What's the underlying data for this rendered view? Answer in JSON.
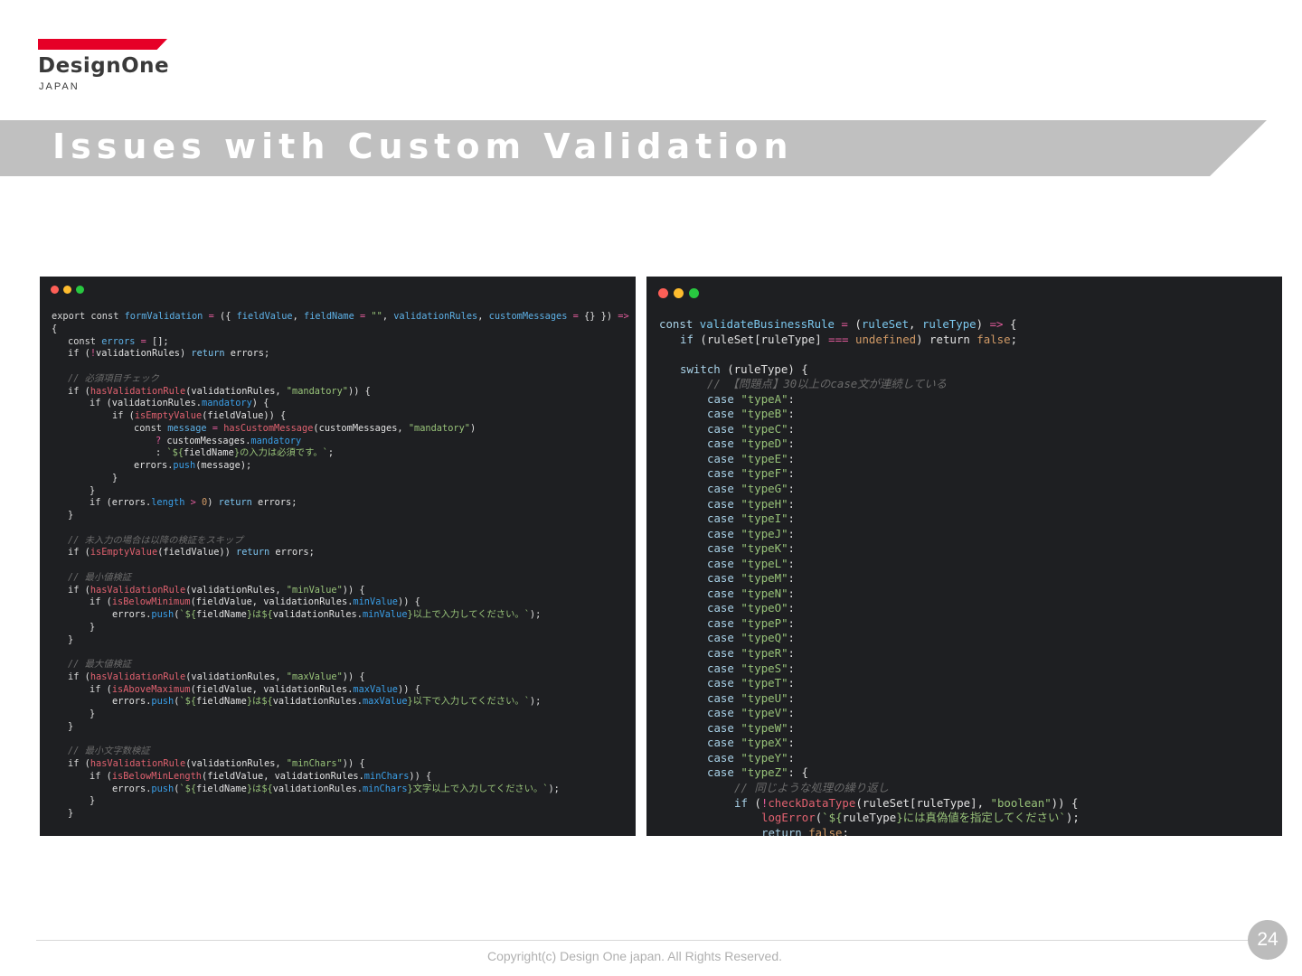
{
  "logo": {
    "name": "DesignOne",
    "sub": "JAPAN",
    "brand_color": "#e60027"
  },
  "title": "Issues with Custom Validation",
  "footer": {
    "copyright": "Copyright(c) Design One japan. All Rights Reserved.",
    "page_number": "24"
  },
  "left_code": [
    {
      "i": 0,
      "t": [
        [
          "k",
          "export const "
        ],
        [
          "v",
          "formValidation"
        ],
        [
          "o",
          " = "
        ],
        [
          "t",
          "({ "
        ],
        [
          "v",
          "fieldValue"
        ],
        [
          "t",
          ", "
        ],
        [
          "v",
          "fieldName"
        ],
        [
          "o",
          " = "
        ],
        [
          "s",
          "\"\""
        ],
        [
          "t",
          ", "
        ],
        [
          "v",
          "validationRules"
        ],
        [
          "t",
          ", "
        ],
        [
          "v",
          "customMessages"
        ],
        [
          "o",
          " = "
        ],
        [
          "t",
          "{} }) "
        ],
        [
          "o",
          "=>"
        ]
      ]
    },
    {
      "i": 0,
      "t": [
        [
          "t",
          "{"
        ]
      ]
    },
    {
      "i": 1,
      "t": [
        [
          "k",
          "const "
        ],
        [
          "v",
          "errors"
        ],
        [
          "o",
          " = "
        ],
        [
          "t",
          "[];"
        ]
      ]
    },
    {
      "i": 1,
      "t": [
        [
          "k",
          "if "
        ],
        [
          "t",
          "("
        ],
        [
          "o",
          "!"
        ],
        [
          "t",
          "validationRules) "
        ],
        [
          "r",
          "return"
        ],
        [
          "t",
          " errors;"
        ]
      ]
    },
    {
      "i": 0,
      "t": []
    },
    {
      "i": 1,
      "t": [
        [
          "c",
          "// 必須項目チェック"
        ]
      ]
    },
    {
      "i": 1,
      "t": [
        [
          "k",
          "if "
        ],
        [
          "t",
          "("
        ],
        [
          "f",
          "hasValidationRule"
        ],
        [
          "t",
          "(validationRules, "
        ],
        [
          "s",
          "\"mandatory\""
        ],
        [
          "t",
          ")) {"
        ]
      ]
    },
    {
      "i": 2,
      "t": [
        [
          "k",
          "if "
        ],
        [
          "t",
          "(validationRules."
        ],
        [
          "p",
          "mandatory"
        ],
        [
          "t",
          ") {"
        ]
      ]
    },
    {
      "i": 3,
      "t": [
        [
          "k",
          "if "
        ],
        [
          "t",
          "("
        ],
        [
          "f",
          "isEmptyValue"
        ],
        [
          "t",
          "(fieldValue)) {"
        ]
      ]
    },
    {
      "i": 4,
      "t": [
        [
          "k",
          "const "
        ],
        [
          "v",
          "message"
        ],
        [
          "o",
          " = "
        ],
        [
          "f",
          "hasCustomMessage"
        ],
        [
          "t",
          "(customMessages, "
        ],
        [
          "s",
          "\"mandatory\""
        ],
        [
          "t",
          ")"
        ]
      ]
    },
    {
      "i": 5,
      "t": [
        [
          "o",
          "? "
        ],
        [
          "t",
          "customMessages."
        ],
        [
          "p",
          "mandatory"
        ]
      ]
    },
    {
      "i": 5,
      "t": [
        [
          "t",
          ": "
        ],
        [
          "s",
          "`${"
        ],
        [
          "t",
          "fieldName"
        ],
        [
          "s",
          "}の入力は必須です。`"
        ],
        [
          "t",
          ";"
        ]
      ]
    },
    {
      "i": 4,
      "t": [
        [
          "t",
          "errors."
        ],
        [
          "p",
          "push"
        ],
        [
          "t",
          "(message);"
        ]
      ]
    },
    {
      "i": 3,
      "t": [
        [
          "t",
          "}"
        ]
      ]
    },
    {
      "i": 2,
      "t": [
        [
          "t",
          "}"
        ]
      ]
    },
    {
      "i": 2,
      "t": [
        [
          "k",
          "if "
        ],
        [
          "t",
          "(errors."
        ],
        [
          "p",
          "length"
        ],
        [
          "o",
          " > "
        ],
        [
          "n",
          "0"
        ],
        [
          "t",
          ") "
        ],
        [
          "r",
          "return"
        ],
        [
          "t",
          " errors;"
        ]
      ]
    },
    {
      "i": 1,
      "t": [
        [
          "t",
          "}"
        ]
      ]
    },
    {
      "i": 0,
      "t": []
    },
    {
      "i": 1,
      "t": [
        [
          "c",
          "// 未入力の場合は以降の検証をスキップ"
        ]
      ]
    },
    {
      "i": 1,
      "t": [
        [
          "k",
          "if "
        ],
        [
          "t",
          "("
        ],
        [
          "f",
          "isEmptyValue"
        ],
        [
          "t",
          "(fieldValue)) "
        ],
        [
          "r",
          "return"
        ],
        [
          "t",
          " errors;"
        ]
      ]
    },
    {
      "i": 0,
      "t": []
    },
    {
      "i": 1,
      "t": [
        [
          "c",
          "// 最小値検証"
        ]
      ]
    },
    {
      "i": 1,
      "t": [
        [
          "k",
          "if "
        ],
        [
          "t",
          "("
        ],
        [
          "f",
          "hasValidationRule"
        ],
        [
          "t",
          "(validationRules, "
        ],
        [
          "s",
          "\"minValue\""
        ],
        [
          "t",
          ")) {"
        ]
      ]
    },
    {
      "i": 2,
      "t": [
        [
          "k",
          "if "
        ],
        [
          "t",
          "("
        ],
        [
          "f",
          "isBelowMinimum"
        ],
        [
          "t",
          "(fieldValue, validationRules."
        ],
        [
          "p",
          "minValue"
        ],
        [
          "t",
          ")) {"
        ]
      ]
    },
    {
      "i": 3,
      "t": [
        [
          "t",
          "errors."
        ],
        [
          "p",
          "push"
        ],
        [
          "t",
          "("
        ],
        [
          "s",
          "`${"
        ],
        [
          "t",
          "fieldName"
        ],
        [
          "s",
          "}は${"
        ],
        [
          "t",
          "validationRules."
        ],
        [
          "p",
          "minValue"
        ],
        [
          "s",
          "}以上で入力してください。`"
        ],
        [
          "t",
          ");"
        ]
      ]
    },
    {
      "i": 2,
      "t": [
        [
          "t",
          "}"
        ]
      ]
    },
    {
      "i": 1,
      "t": [
        [
          "t",
          "}"
        ]
      ]
    },
    {
      "i": 0,
      "t": []
    },
    {
      "i": 1,
      "t": [
        [
          "c",
          "// 最大値検証"
        ]
      ]
    },
    {
      "i": 1,
      "t": [
        [
          "k",
          "if "
        ],
        [
          "t",
          "("
        ],
        [
          "f",
          "hasValidationRule"
        ],
        [
          "t",
          "(validationRules, "
        ],
        [
          "s",
          "\"maxValue\""
        ],
        [
          "t",
          ")) {"
        ]
      ]
    },
    {
      "i": 2,
      "t": [
        [
          "k",
          "if "
        ],
        [
          "t",
          "("
        ],
        [
          "f",
          "isAboveMaximum"
        ],
        [
          "t",
          "(fieldValue, validationRules."
        ],
        [
          "p",
          "maxValue"
        ],
        [
          "t",
          ")) {"
        ]
      ]
    },
    {
      "i": 3,
      "t": [
        [
          "t",
          "errors."
        ],
        [
          "p",
          "push"
        ],
        [
          "t",
          "("
        ],
        [
          "s",
          "`${"
        ],
        [
          "t",
          "fieldName"
        ],
        [
          "s",
          "}は${"
        ],
        [
          "t",
          "validationRules."
        ],
        [
          "p",
          "maxValue"
        ],
        [
          "s",
          "}以下で入力してください。`"
        ],
        [
          "t",
          ");"
        ]
      ]
    },
    {
      "i": 2,
      "t": [
        [
          "t",
          "}"
        ]
      ]
    },
    {
      "i": 1,
      "t": [
        [
          "t",
          "}"
        ]
      ]
    },
    {
      "i": 0,
      "t": []
    },
    {
      "i": 1,
      "t": [
        [
          "c",
          "// 最小文字数検証"
        ]
      ]
    },
    {
      "i": 1,
      "t": [
        [
          "k",
          "if "
        ],
        [
          "t",
          "("
        ],
        [
          "f",
          "hasValidationRule"
        ],
        [
          "t",
          "(validationRules, "
        ],
        [
          "s",
          "\"minChars\""
        ],
        [
          "t",
          ")) {"
        ]
      ]
    },
    {
      "i": 2,
      "t": [
        [
          "k",
          "if "
        ],
        [
          "t",
          "("
        ],
        [
          "f",
          "isBelowMinLength"
        ],
        [
          "t",
          "(fieldValue, validationRules."
        ],
        [
          "p",
          "minChars"
        ],
        [
          "t",
          ")) {"
        ]
      ]
    },
    {
      "i": 3,
      "t": [
        [
          "t",
          "errors."
        ],
        [
          "p",
          "push"
        ],
        [
          "t",
          "("
        ],
        [
          "s",
          "`${"
        ],
        [
          "t",
          "fieldName"
        ],
        [
          "s",
          "}は${"
        ],
        [
          "t",
          "validationRules."
        ],
        [
          "p",
          "minChars"
        ],
        [
          "s",
          "}文字以上で入力してください。`"
        ],
        [
          "t",
          ");"
        ]
      ]
    },
    {
      "i": 2,
      "t": [
        [
          "t",
          "}"
        ]
      ]
    },
    {
      "i": 1,
      "t": [
        [
          "t",
          "}"
        ]
      ]
    }
  ],
  "right_code": [
    {
      "i": 0,
      "t": [
        [
          "k",
          "const "
        ],
        [
          "v",
          "validateBusinessRule"
        ],
        [
          "o",
          " = "
        ],
        [
          "t",
          "("
        ],
        [
          "v",
          "ruleSet"
        ],
        [
          "t",
          ", "
        ],
        [
          "v",
          "ruleType"
        ],
        [
          "t",
          ") "
        ],
        [
          "o",
          "=>"
        ],
        [
          "t",
          " {"
        ]
      ]
    },
    {
      "i": 1,
      "t": [
        [
          "k",
          "if "
        ],
        [
          "t",
          "(ruleSet[ruleType] "
        ],
        [
          "o",
          "==="
        ],
        [
          "n",
          " undefined"
        ],
        [
          "t",
          ") return "
        ],
        [
          "n",
          "false"
        ],
        [
          "t",
          ";"
        ]
      ]
    },
    {
      "i": 0,
      "t": []
    },
    {
      "i": 1,
      "t": [
        [
          "k",
          "switch "
        ],
        [
          "t",
          "(ruleType) {"
        ]
      ]
    },
    {
      "i": 2,
      "t": [
        [
          "c",
          "// 【問題点】30以上のcase文が連続している"
        ]
      ]
    },
    {
      "i": 2,
      "t": [
        [
          "k",
          "case "
        ],
        [
          "s",
          "\"typeA\""
        ],
        [
          "t",
          ":"
        ]
      ]
    },
    {
      "i": 2,
      "t": [
        [
          "k",
          "case "
        ],
        [
          "s",
          "\"typeB\""
        ],
        [
          "t",
          ":"
        ]
      ]
    },
    {
      "i": 2,
      "t": [
        [
          "k",
          "case "
        ],
        [
          "s",
          "\"typeC\""
        ],
        [
          "t",
          ":"
        ]
      ]
    },
    {
      "i": 2,
      "t": [
        [
          "k",
          "case "
        ],
        [
          "s",
          "\"typeD\""
        ],
        [
          "t",
          ":"
        ]
      ]
    },
    {
      "i": 2,
      "t": [
        [
          "k",
          "case "
        ],
        [
          "s",
          "\"typeE\""
        ],
        [
          "t",
          ":"
        ]
      ]
    },
    {
      "i": 2,
      "t": [
        [
          "k",
          "case "
        ],
        [
          "s",
          "\"typeF\""
        ],
        [
          "t",
          ":"
        ]
      ]
    },
    {
      "i": 2,
      "t": [
        [
          "k",
          "case "
        ],
        [
          "s",
          "\"typeG\""
        ],
        [
          "t",
          ":"
        ]
      ]
    },
    {
      "i": 2,
      "t": [
        [
          "k",
          "case "
        ],
        [
          "s",
          "\"typeH\""
        ],
        [
          "t",
          ":"
        ]
      ]
    },
    {
      "i": 2,
      "t": [
        [
          "k",
          "case "
        ],
        [
          "s",
          "\"typeI\""
        ],
        [
          "t",
          ":"
        ]
      ]
    },
    {
      "i": 2,
      "t": [
        [
          "k",
          "case "
        ],
        [
          "s",
          "\"typeJ\""
        ],
        [
          "t",
          ":"
        ]
      ]
    },
    {
      "i": 2,
      "t": [
        [
          "k",
          "case "
        ],
        [
          "s",
          "\"typeK\""
        ],
        [
          "t",
          ":"
        ]
      ]
    },
    {
      "i": 2,
      "t": [
        [
          "k",
          "case "
        ],
        [
          "s",
          "\"typeL\""
        ],
        [
          "t",
          ":"
        ]
      ]
    },
    {
      "i": 2,
      "t": [
        [
          "k",
          "case "
        ],
        [
          "s",
          "\"typeM\""
        ],
        [
          "t",
          ":"
        ]
      ]
    },
    {
      "i": 2,
      "t": [
        [
          "k",
          "case "
        ],
        [
          "s",
          "\"typeN\""
        ],
        [
          "t",
          ":"
        ]
      ]
    },
    {
      "i": 2,
      "t": [
        [
          "k",
          "case "
        ],
        [
          "s",
          "\"typeO\""
        ],
        [
          "t",
          ":"
        ]
      ]
    },
    {
      "i": 2,
      "t": [
        [
          "k",
          "case "
        ],
        [
          "s",
          "\"typeP\""
        ],
        [
          "t",
          ":"
        ]
      ]
    },
    {
      "i": 2,
      "t": [
        [
          "k",
          "case "
        ],
        [
          "s",
          "\"typeQ\""
        ],
        [
          "t",
          ":"
        ]
      ]
    },
    {
      "i": 2,
      "t": [
        [
          "k",
          "case "
        ],
        [
          "s",
          "\"typeR\""
        ],
        [
          "t",
          ":"
        ]
      ]
    },
    {
      "i": 2,
      "t": [
        [
          "k",
          "case "
        ],
        [
          "s",
          "\"typeS\""
        ],
        [
          "t",
          ":"
        ]
      ]
    },
    {
      "i": 2,
      "t": [
        [
          "k",
          "case "
        ],
        [
          "s",
          "\"typeT\""
        ],
        [
          "t",
          ":"
        ]
      ]
    },
    {
      "i": 2,
      "t": [
        [
          "k",
          "case "
        ],
        [
          "s",
          "\"typeU\""
        ],
        [
          "t",
          ":"
        ]
      ]
    },
    {
      "i": 2,
      "t": [
        [
          "k",
          "case "
        ],
        [
          "s",
          "\"typeV\""
        ],
        [
          "t",
          ":"
        ]
      ]
    },
    {
      "i": 2,
      "t": [
        [
          "k",
          "case "
        ],
        [
          "s",
          "\"typeW\""
        ],
        [
          "t",
          ":"
        ]
      ]
    },
    {
      "i": 2,
      "t": [
        [
          "k",
          "case "
        ],
        [
          "s",
          "\"typeX\""
        ],
        [
          "t",
          ":"
        ]
      ]
    },
    {
      "i": 2,
      "t": [
        [
          "k",
          "case "
        ],
        [
          "s",
          "\"typeY\""
        ],
        [
          "t",
          ":"
        ]
      ]
    },
    {
      "i": 2,
      "t": [
        [
          "k",
          "case "
        ],
        [
          "s",
          "\"typeZ\""
        ],
        [
          "t",
          ": {"
        ]
      ]
    },
    {
      "i": 3,
      "t": [
        [
          "c",
          "// 同じような処理の繰り返し"
        ]
      ]
    },
    {
      "i": 3,
      "t": [
        [
          "k",
          "if "
        ],
        [
          "t",
          "("
        ],
        [
          "o",
          "!"
        ],
        [
          "f",
          "checkDataType"
        ],
        [
          "t",
          "(ruleSet[ruleType], "
        ],
        [
          "s",
          "\"boolean\""
        ],
        [
          "t",
          ")) {"
        ]
      ]
    },
    {
      "i": 4,
      "t": [
        [
          "f",
          "logError"
        ],
        [
          "t",
          "("
        ],
        [
          "s",
          "`${"
        ],
        [
          "t",
          "ruleType"
        ],
        [
          "s",
          "}には真偽値を指定してください`"
        ],
        [
          "t",
          ");"
        ]
      ]
    },
    {
      "i": 4,
      "t": [
        [
          "k",
          "return "
        ],
        [
          "n",
          "false"
        ],
        [
          "t",
          ";"
        ]
      ]
    }
  ]
}
